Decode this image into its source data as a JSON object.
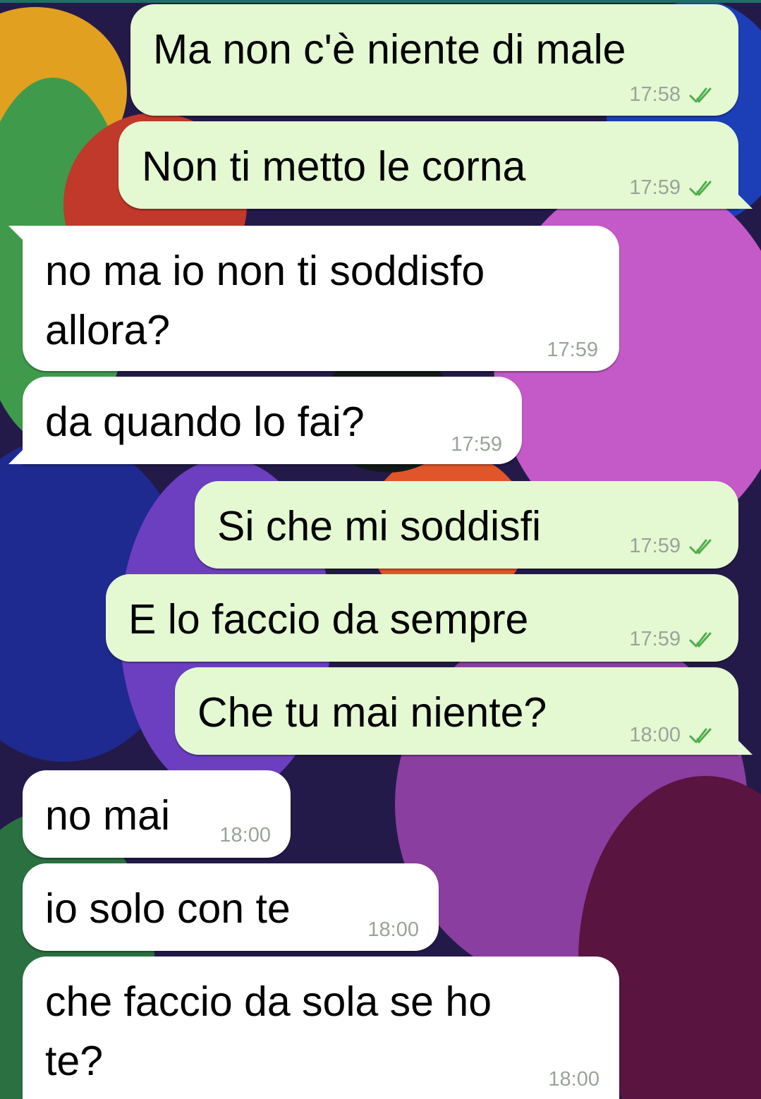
{
  "colors": {
    "outgoing_bubble": "#e4f8d2",
    "incoming_bubble": "#ffffff",
    "timestamp": "#9aa39a",
    "read_ticks": "#4fae4a"
  },
  "chat": {
    "messages": [
      {
        "direction": "outgoing",
        "text": "Ma non c'è niente di male",
        "time": "17:58",
        "status_icon": "double-check-icon"
      },
      {
        "direction": "outgoing",
        "text": "Non ti metto le corna",
        "time": "17:59",
        "status_icon": "double-check-icon"
      },
      {
        "direction": "incoming",
        "text": "no ma io non ti soddisfo\nallora?",
        "time": "17:59"
      },
      {
        "direction": "incoming",
        "text": "da quando lo fai?",
        "time": "17:59"
      },
      {
        "direction": "outgoing",
        "text": "Si che mi soddisfi",
        "time": "17:59",
        "status_icon": "double-check-icon"
      },
      {
        "direction": "outgoing",
        "text": "E lo faccio da sempre",
        "time": "17:59",
        "status_icon": "double-check-icon"
      },
      {
        "direction": "outgoing",
        "text": "Che tu mai niente?",
        "time": "18:00",
        "status_icon": "double-check-icon"
      },
      {
        "direction": "incoming",
        "text": "no mai",
        "time": "18:00"
      },
      {
        "direction": "incoming",
        "text": "io solo con te",
        "time": "18:00"
      },
      {
        "direction": "incoming",
        "text": "che faccio da sola se ho\nte?",
        "time": "18:00"
      }
    ]
  }
}
